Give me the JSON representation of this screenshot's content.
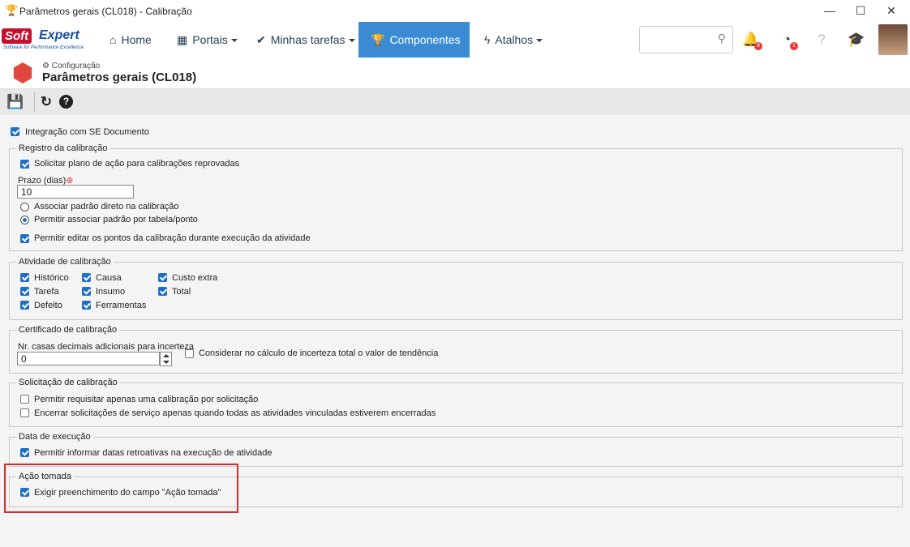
{
  "window": {
    "title": "Parâmetros gerais (CL018) - Calibração",
    "minimize": "—",
    "maximize": "☐",
    "close": "✕"
  },
  "logo": {
    "soft": "Soft",
    "expert": "Expert",
    "tagline": "Software for Performance Excellence"
  },
  "nav": {
    "home": "Home",
    "portais": "Portais",
    "tarefas": "Minhas tarefas",
    "componentes": "Componentes",
    "atalhos": "Atalhos"
  },
  "badges": {
    "notifications": "8",
    "alerts": "1"
  },
  "header": {
    "breadcrumb": "Configuração",
    "title": "Parâmetros gerais (CL018)"
  },
  "form": {
    "integracao": "Integração com SE Documento",
    "registro": {
      "legend": "Registro da calibração",
      "solicitar_plano": "Solicitar plano de ação para calibrações reprovadas",
      "prazo_label": "Prazo (dias)",
      "prazo_value": "10",
      "assoc_direto": "Associar padrão direto na calibração",
      "assoc_tabela": "Permitir associar padrão por tabela/ponto",
      "editar_pontos": "Permitir editar os pontos da calibração durante execução da atividade"
    },
    "atividade": {
      "legend": "Atividade de calibração",
      "historico": "Histórico",
      "tarefa": "Tarefa",
      "defeito": "Defeito",
      "causa": "Causa",
      "insumo": "Insumo",
      "ferramentas": "Ferramentas",
      "custo_extra": "Custo extra",
      "total": "Total"
    },
    "certificado": {
      "legend": "Certificado de calibração",
      "casas_label": "Nr. casas decimais adicionais para incerteza",
      "casas_value": "0",
      "considerar": "Considerar no cálculo de incerteza total o valor de tendência"
    },
    "solicitacao": {
      "legend": "Solicitação de calibração",
      "apenas_uma": "Permitir requisitar apenas uma calibração por solicitação",
      "encerrar": "Encerrar solicitações de serviço apenas quando todas as atividades vinculadas estiverem encerradas"
    },
    "data_execucao": {
      "legend": "Data de execução",
      "retroativas": "Permitir informar datas retroativas na execução de atividade"
    },
    "acao_tomada": {
      "legend": "Ação tomada",
      "exigir": "Exigir preenchimento do campo \"Ação tomada\""
    }
  }
}
